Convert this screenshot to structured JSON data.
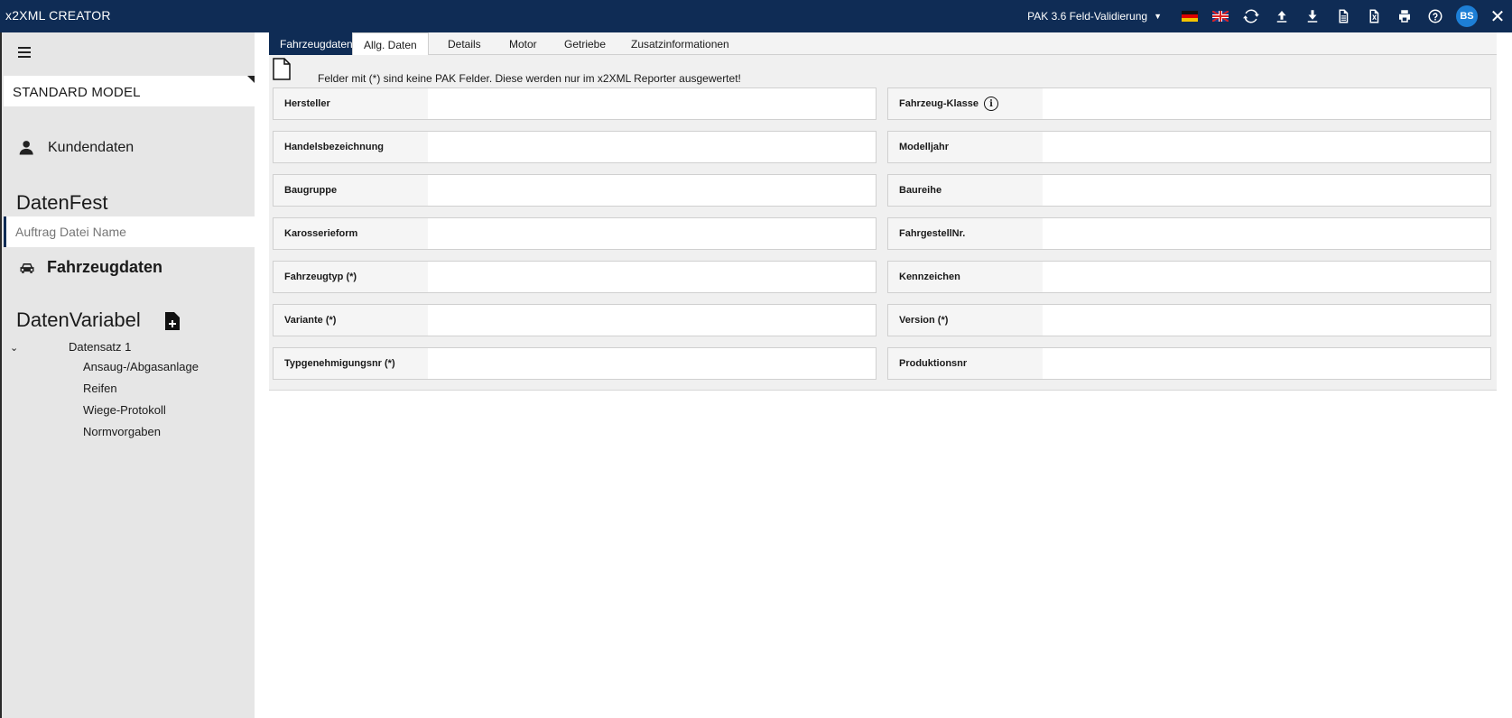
{
  "app": {
    "title": "x2XML CREATOR"
  },
  "titlebar": {
    "validation_label": "PAK 3.6 Feld-Validierung",
    "avatar_initials": "BS",
    "close_label": "✕",
    "icons": [
      "flag-de-icon",
      "flag-uk-icon",
      "refresh-icon",
      "upload-icon",
      "download-icon",
      "document-icon",
      "excel-icon",
      "print-icon",
      "help-icon"
    ]
  },
  "sidebar": {
    "model": "STANDARD MODEL",
    "kundendaten": "Kundendaten",
    "datenfest": "DatenFest",
    "auftrag_placeholder": "Auftrag Datei Name",
    "fahrzeugdaten": "Fahrzeugdaten",
    "datenvariabel": "DatenVariabel",
    "tree": {
      "toggle": "⌄",
      "root": "Datensatz 1",
      "children": [
        "Ansaug-/Abgasanlage",
        "Reifen",
        "Wiege-Protokoll",
        "Normvorgaben"
      ]
    }
  },
  "tabs": [
    "Fahrzeugdaten",
    "Allg. Daten",
    "Details",
    "Motor",
    "Getriebe",
    "Zusatzinformationen"
  ],
  "notice": "Felder mit (*) sind keine PAK Felder. Diese werden nur im x2XML Reporter ausgewertet!",
  "fields": {
    "left": [
      "Hersteller",
      "Handelsbezeichnung",
      "Baugruppe",
      "Karosserieform",
      "Fahrzeugtyp (*)",
      "Variante (*)",
      "Typgenehmigungsnr (*)"
    ],
    "right": [
      "Fahrzeug-Klasse",
      "Modelljahr",
      "Baureihe",
      "FahrgestellNr.",
      "Kennzeichen",
      "Version (*)",
      "Produktionsnr"
    ],
    "info_symbol": "i"
  },
  "colors": {
    "titlebar": "#0f2c55",
    "sidebar": "#e6e6e6",
    "avatar": "#1d7fd6"
  }
}
